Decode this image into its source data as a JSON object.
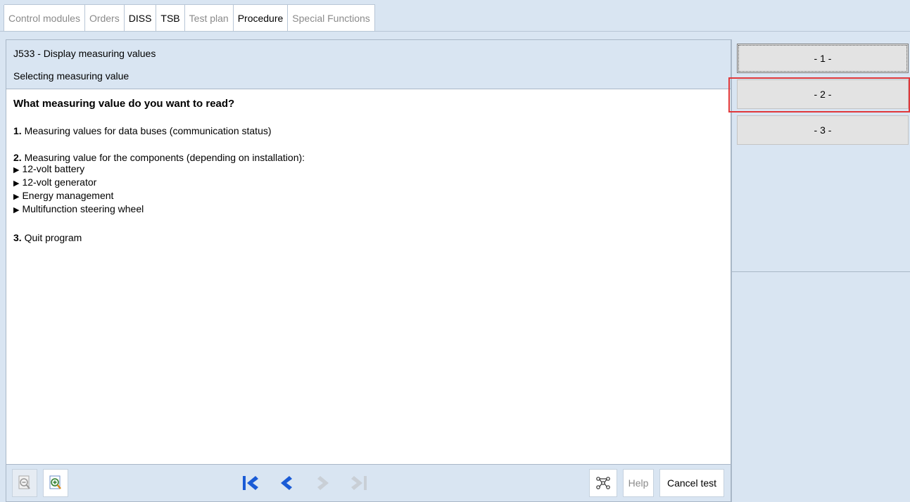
{
  "tabs": [
    {
      "label": "Control modules",
      "state": "disabled"
    },
    {
      "label": "Orders",
      "state": "disabled"
    },
    {
      "label": "DISS",
      "state": "active"
    },
    {
      "label": "TSB",
      "state": "active"
    },
    {
      "label": "Test plan",
      "state": "disabled"
    },
    {
      "label": "Procedure",
      "state": "selected"
    },
    {
      "label": "Special Functions",
      "state": "disabled"
    }
  ],
  "header": {
    "title": "J533 - Display measuring values",
    "subtitle": "Selecting measuring value"
  },
  "content": {
    "question": "What measuring value do you want to read?",
    "options": [
      {
        "num": "1.",
        "text": " Measuring values for data buses (communication status)",
        "bullets": []
      },
      {
        "num": "2.",
        "text": " Measuring value for the components (depending on installation):",
        "bullets": [
          "12-volt battery",
          "12-volt generator",
          "Energy management",
          "Multifunction steering wheel"
        ]
      },
      {
        "num": "3.",
        "text": " Quit program",
        "bullets": []
      }
    ]
  },
  "side_buttons": [
    "- 1 -",
    "- 2 -",
    "- 3 -"
  ],
  "footer": {
    "help_label": "Help",
    "cancel_label": "Cancel test"
  },
  "colors": {
    "accent_blue": "#1a5bd6",
    "highlight_red": "#e0383a",
    "panel_bg": "#d9e5f2"
  }
}
